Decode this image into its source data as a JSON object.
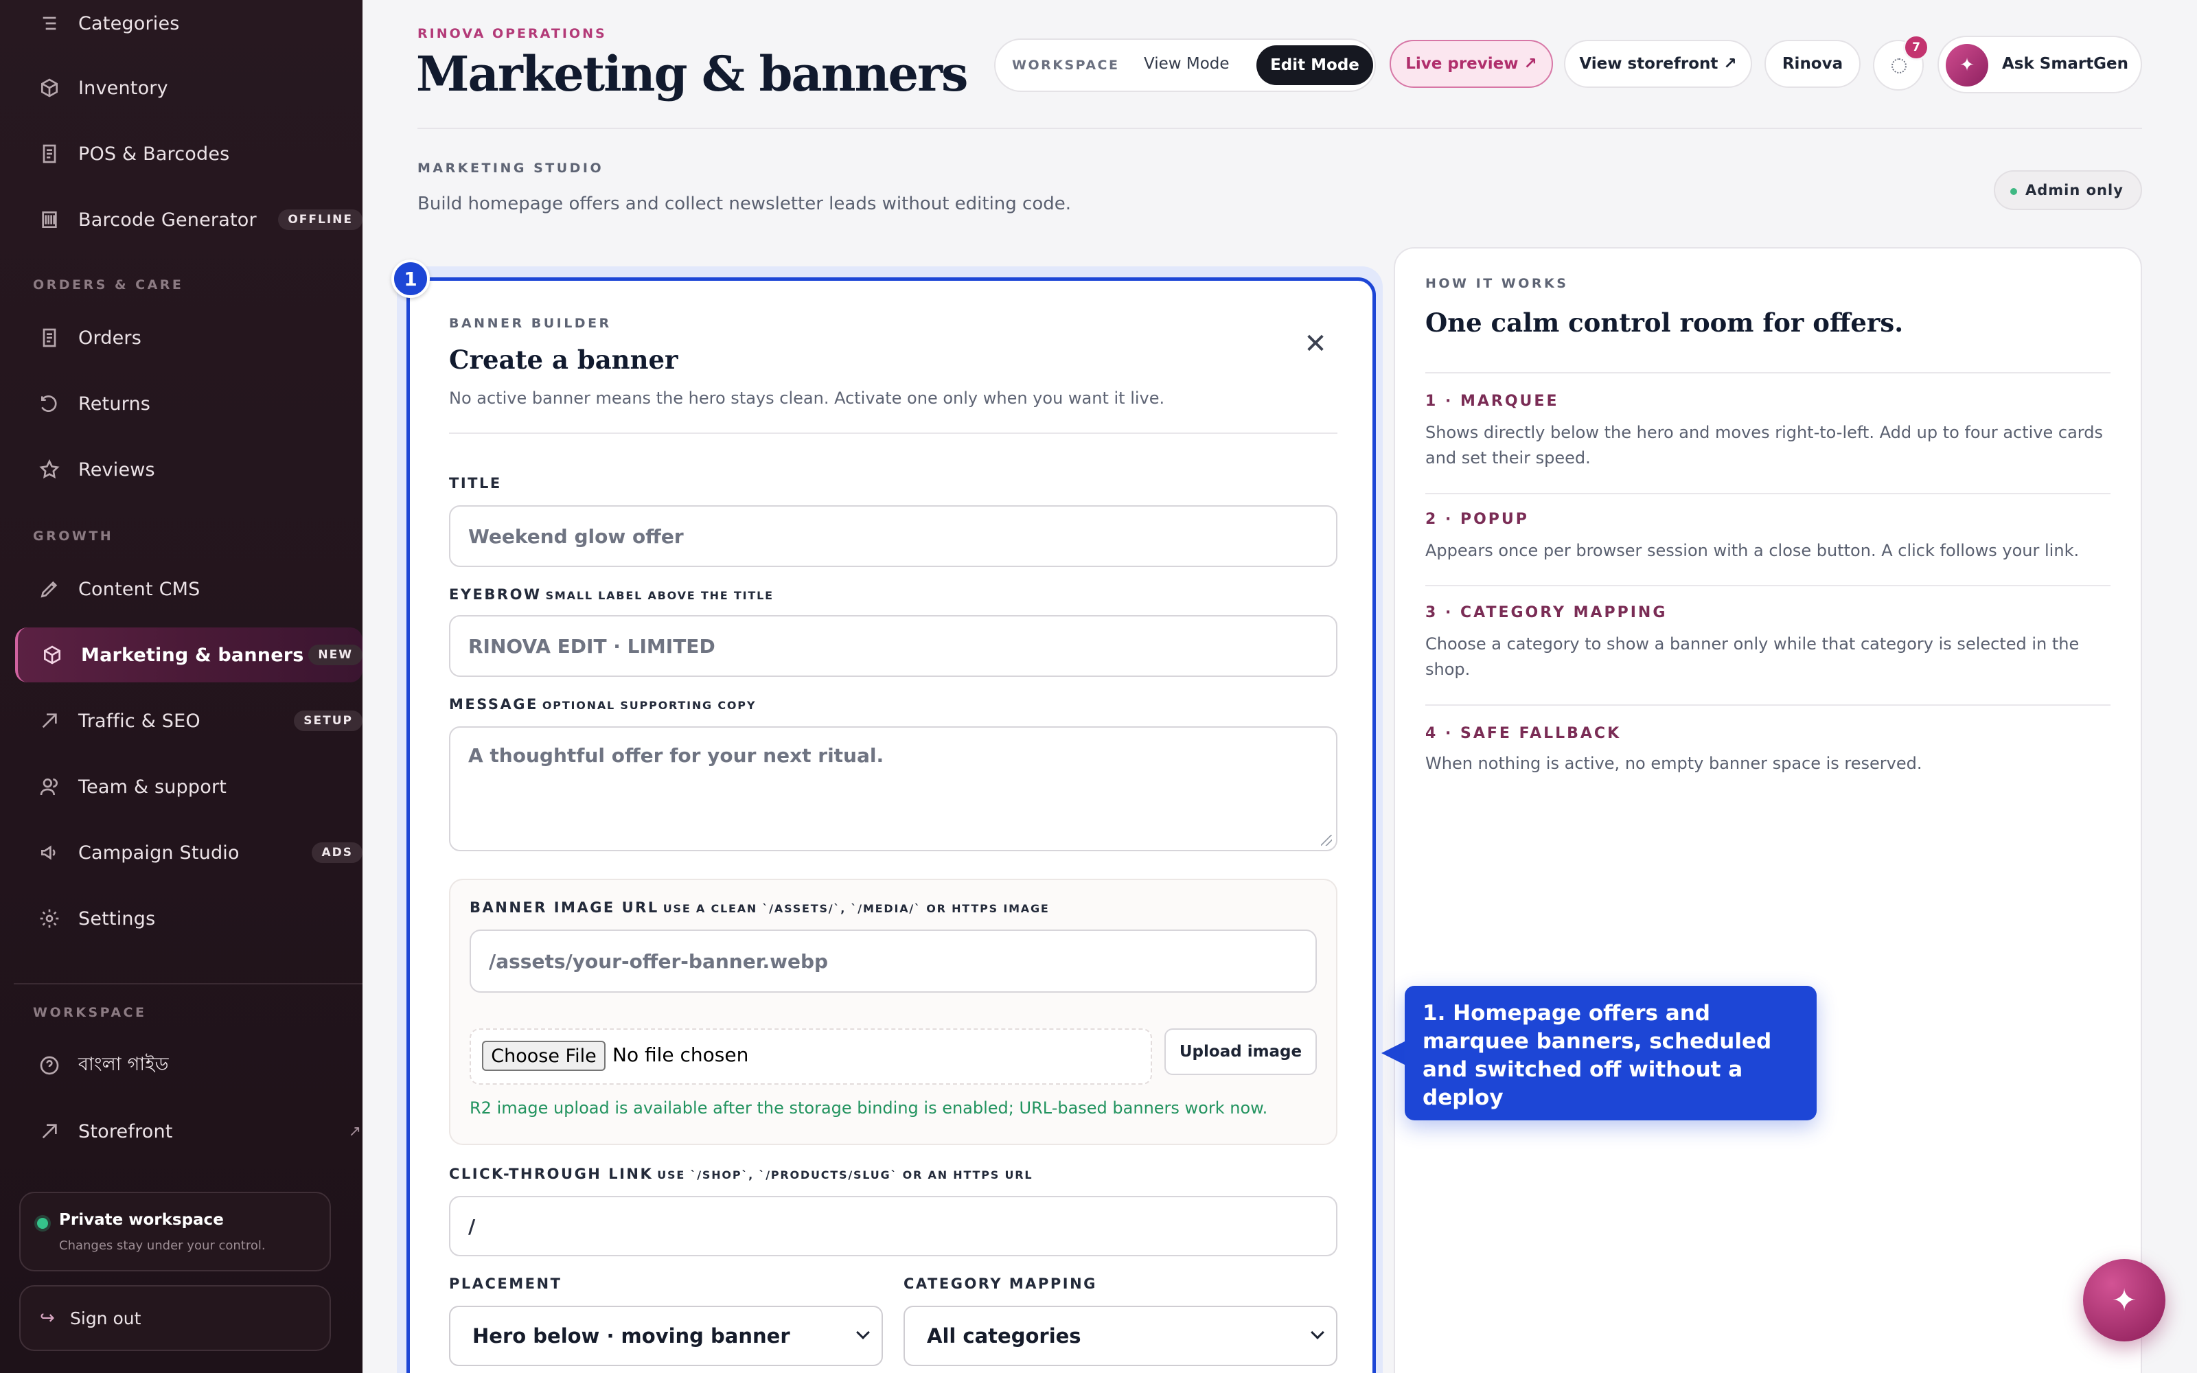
{
  "sidebar": {
    "items": [
      {
        "label": "Categories",
        "icon": "list-icon"
      },
      {
        "label": "Inventory",
        "icon": "box-icon"
      },
      {
        "label": "POS & Barcodes",
        "icon": "receipt-icon"
      },
      {
        "label": "Barcode Generator",
        "icon": "barcode-icon",
        "badge": "OFFLINE"
      },
      {
        "label": "Orders",
        "icon": "receipt-icon"
      },
      {
        "label": "Returns",
        "icon": "return-icon"
      },
      {
        "label": "Reviews",
        "icon": "star-icon"
      },
      {
        "label": "Content CMS",
        "icon": "pen-icon"
      },
      {
        "label": "Marketing & banners",
        "icon": "box-icon",
        "badge": "NEW",
        "active": true
      },
      {
        "label": "Traffic & SEO",
        "icon": "trend-icon",
        "badge": "SETUP"
      },
      {
        "label": "Team & support",
        "icon": "team-icon"
      },
      {
        "label": "Campaign Studio",
        "icon": "megaphone-icon",
        "badge": "ADS"
      },
      {
        "label": "Settings",
        "icon": "gear-icon"
      },
      {
        "label": "বাংলা গাইড",
        "icon": "help-icon"
      },
      {
        "label": "Storefront",
        "icon": "trend-icon",
        "trailing": "↗"
      }
    ],
    "sections": {
      "orders_care": "ORDERS & CARE",
      "growth": "GROWTH",
      "workspace": "WORKSPACE"
    },
    "private": {
      "title": "Private workspace",
      "subtitle": "Changes stay under your control."
    },
    "signout": {
      "arrow": "↪",
      "label": "Sign out"
    }
  },
  "header": {
    "eyebrow": "RINOVA OPERATIONS",
    "title": "Marketing & banners",
    "workspace_label": "WORKSPACE",
    "view_mode": "View Mode",
    "edit_mode": "Edit Mode",
    "live_preview": "Live preview ↗",
    "view_storefront": "View storefront ↗",
    "store": "Rinova",
    "notifications": "7",
    "ask_icon": "✦",
    "ask": "Ask SmartGen"
  },
  "studio": {
    "label": "MARKETING STUDIO",
    "description": "Build homepage offers and collect newsletter leads without editing code.",
    "admin": "Admin only"
  },
  "builder": {
    "step": "1",
    "eyebrow": "BANNER BUILDER",
    "title": "Create a banner",
    "subtitle": "No active banner means the hero stays clean. Activate one only when you want it live.",
    "close": "✕",
    "fields": {
      "title_label": "TITLE",
      "title_placeholder": "Weekend glow offer",
      "eyebrow_label": "EYEBROW",
      "eyebrow_hint": "SMALL LABEL ABOVE THE TITLE",
      "eyebrow_placeholder": "RINOVA EDIT · LIMITED",
      "message_label": "MESSAGE",
      "message_hint": "OPTIONAL SUPPORTING COPY",
      "message_placeholder": "A thoughtful offer for your next ritual.",
      "image_label": "BANNER IMAGE URL",
      "image_hint": "USE A CLEAN `/ASSETS/`, `/MEDIA/` OR HTTPS IMAGE",
      "image_placeholder": "/assets/your-offer-banner.webp",
      "choose_file": "Choose File",
      "no_file": "No file chosen",
      "upload": "Upload image",
      "r2_note": "R2 image upload is available after the storage binding is enabled; URL-based banners work now.",
      "link_label": "CLICK-THROUGH LINK",
      "link_hint": "USE `/SHOP`, `/PRODUCTS/SLUG` OR AN HTTPS URL",
      "link_value": "/",
      "placement_label": "PLACEMENT",
      "placement_value": "Hero below · moving banner",
      "category_label": "CATEGORY MAPPING",
      "category_value": "All categories"
    }
  },
  "how": {
    "eyebrow": "HOW IT WORKS",
    "title": "One calm control room for offers.",
    "steps": [
      {
        "heading": "1 · MARQUEE",
        "text": "Shows directly below the hero and moves right-to-left. Add up to four active cards and set their speed."
      },
      {
        "heading": "2 · POPUP",
        "text": "Appears once per browser session with a close button. A click follows your link."
      },
      {
        "heading": "3 · CATEGORY MAPPING",
        "text": "Choose a category to show a banner only while that category is selected in the shop."
      },
      {
        "heading": "4 · SAFE FALLBACK",
        "text": "When nothing is active, no empty banner space is reserved."
      }
    ]
  },
  "callout": {
    "text": "1. Homepage offers and marquee banners, scheduled and switched off without a deploy"
  },
  "fab": {
    "icon": "✦"
  },
  "colors": {
    "accent": "#b33a78",
    "highlight_blue": "#1d46d6",
    "sidebar_bg": "#271820",
    "success": "#22935f"
  }
}
